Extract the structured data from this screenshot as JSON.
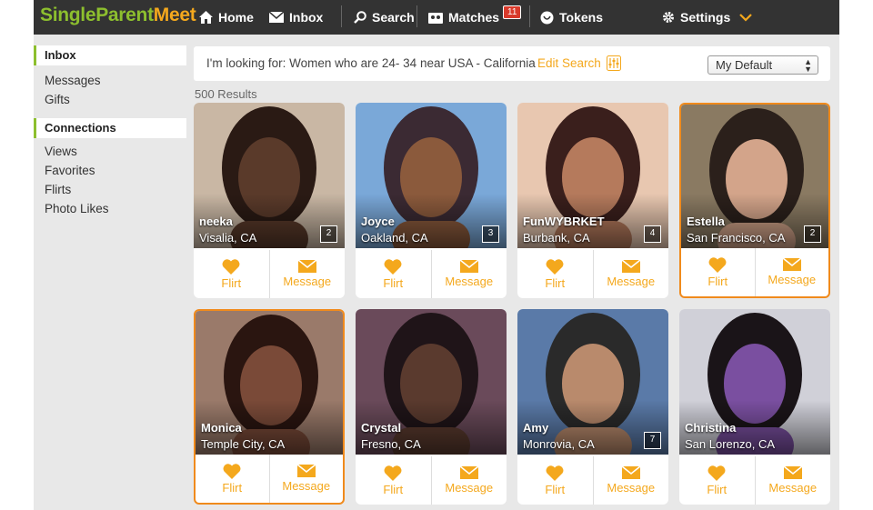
{
  "brand": {
    "part1": "Single",
    "part2": "Parent",
    "part3": "Meet"
  },
  "nav": {
    "home": "Home",
    "inbox": "Inbox",
    "search": "Search",
    "matches": "Matches",
    "matches_count": "11",
    "tokens": "Tokens",
    "settings": "Settings"
  },
  "sidebar": {
    "inbox_head": "Inbox",
    "inbox_items": [
      "Messages",
      "Gifts"
    ],
    "connections_head": "Connections",
    "connection_items": [
      "Views",
      "Favorites",
      "Flirts",
      "Photo Likes"
    ]
  },
  "search": {
    "criteria": "I'm looking for: Women who are 24- 34 near USA - California",
    "edit_label": "Edit Search",
    "sort_value": "My Default"
  },
  "results_label": "500 Results",
  "actions": {
    "flirt": "Flirt",
    "message": "Message"
  },
  "profiles": [
    {
      "name": "neeka",
      "location": "Visalia, CA",
      "photos": "2",
      "highlighted": false
    },
    {
      "name": "Joyce",
      "location": "Oakland, CA",
      "photos": "3",
      "highlighted": false
    },
    {
      "name": "FunWYBRKET",
      "location": "Burbank, CA",
      "photos": "4",
      "highlighted": false
    },
    {
      "name": "Estella",
      "location": "San Francisco, CA",
      "photos": "2",
      "highlighted": true
    },
    {
      "name": "Monica",
      "location": "Temple City, CA",
      "photos": "",
      "highlighted": true
    },
    {
      "name": "Crystal",
      "location": "Fresno, CA",
      "photos": "",
      "highlighted": false
    },
    {
      "name": "Amy",
      "location": "Monrovia, CA",
      "photos": "7",
      "highlighted": false
    },
    {
      "name": "Christina",
      "location": "San Lorenzo, CA",
      "photos": "",
      "highlighted": false
    }
  ],
  "colors": {
    "accent": "#f4a81d",
    "brand_green": "#8dbf2e",
    "highlight_border": "#f08a1c",
    "topbar": "#333333"
  }
}
